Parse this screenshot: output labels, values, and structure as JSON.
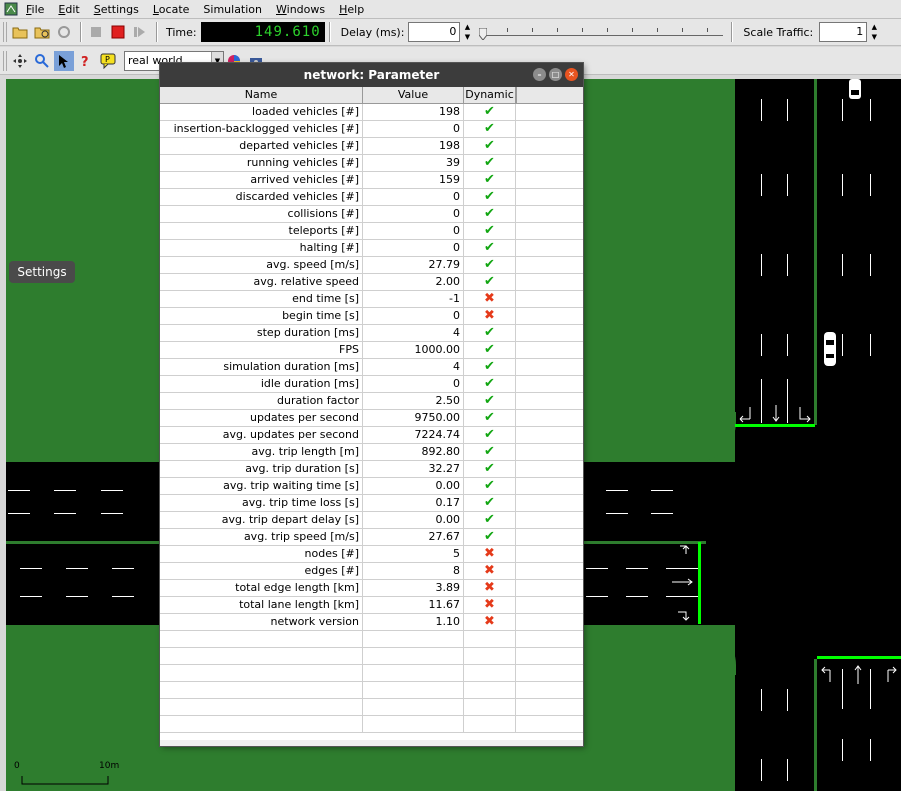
{
  "menu": {
    "items": [
      {
        "pre": "",
        "u": "F",
        "post": "ile"
      },
      {
        "pre": "",
        "u": "E",
        "post": "dit"
      },
      {
        "pre": "",
        "u": "S",
        "post": "ettings"
      },
      {
        "pre": "",
        "u": "L",
        "post": "ocate"
      },
      {
        "pre": "Simulation",
        "u": "",
        "post": ""
      },
      {
        "pre": "",
        "u": "W",
        "post": "indows"
      },
      {
        "pre": "",
        "u": "H",
        "post": "elp"
      }
    ]
  },
  "toolbar": {
    "time_label": "Time:",
    "time_value": "149.610",
    "delay_label": "Delay (ms):",
    "delay_value": "0",
    "scale_traffic_label": "Scale Traffic:",
    "scale_traffic_value": "1",
    "viewport_combo": "real world"
  },
  "canvas": {
    "settings_label": "Settings",
    "scale_start": "0",
    "scale_end": "10m"
  },
  "dialog": {
    "title": "network: Parameter",
    "columns": [
      "Name",
      "Value",
      "Dynamic"
    ],
    "rows": [
      {
        "name": "loaded vehicles [#]",
        "value": "198",
        "dynamic": true
      },
      {
        "name": "insertion-backlogged vehicles [#]",
        "value": "0",
        "dynamic": true
      },
      {
        "name": "departed vehicles [#]",
        "value": "198",
        "dynamic": true
      },
      {
        "name": "running vehicles [#]",
        "value": "39",
        "dynamic": true
      },
      {
        "name": "arrived vehicles [#]",
        "value": "159",
        "dynamic": true
      },
      {
        "name": "discarded vehicles [#]",
        "value": "0",
        "dynamic": true
      },
      {
        "name": "collisions [#]",
        "value": "0",
        "dynamic": true
      },
      {
        "name": "teleports [#]",
        "value": "0",
        "dynamic": true
      },
      {
        "name": "halting [#]",
        "value": "0",
        "dynamic": true
      },
      {
        "name": "avg. speed [m/s]",
        "value": "27.79",
        "dynamic": true
      },
      {
        "name": "avg. relative speed",
        "value": "2.00",
        "dynamic": true
      },
      {
        "name": "end time [s]",
        "value": "-1",
        "dynamic": false
      },
      {
        "name": "begin time [s]",
        "value": "0",
        "dynamic": false
      },
      {
        "name": "step duration [ms]",
        "value": "4",
        "dynamic": true
      },
      {
        "name": "FPS",
        "value": "1000.00",
        "dynamic": true
      },
      {
        "name": "simulation duration [ms]",
        "value": "4",
        "dynamic": true
      },
      {
        "name": "idle duration [ms]",
        "value": "0",
        "dynamic": true
      },
      {
        "name": "duration factor",
        "value": "2.50",
        "dynamic": true
      },
      {
        "name": "updates per second",
        "value": "9750.00",
        "dynamic": true
      },
      {
        "name": "avg. updates per second",
        "value": "7224.74",
        "dynamic": true
      },
      {
        "name": "avg. trip length [m]",
        "value": "892.80",
        "dynamic": true
      },
      {
        "name": "avg. trip duration [s]",
        "value": "32.27",
        "dynamic": true
      },
      {
        "name": "avg. trip waiting time [s]",
        "value": "0.00",
        "dynamic": true
      },
      {
        "name": "avg. trip time loss [s]",
        "value": "0.17",
        "dynamic": true
      },
      {
        "name": "avg. trip depart delay [s]",
        "value": "0.00",
        "dynamic": true
      },
      {
        "name": "avg. trip speed [m/s]",
        "value": "27.67",
        "dynamic": true
      },
      {
        "name": "nodes [#]",
        "value": "5",
        "dynamic": false
      },
      {
        "name": "edges [#]",
        "value": "8",
        "dynamic": false
      },
      {
        "name": "total edge length [km]",
        "value": "3.89",
        "dynamic": false
      },
      {
        "name": "total lane length [km]",
        "value": "11.67",
        "dynamic": false
      },
      {
        "name": "network version",
        "value": "1.10",
        "dynamic": false
      }
    ],
    "empty_rows": 6,
    "dynamic_true_symbol": "✔",
    "dynamic_false_symbol": "✖"
  },
  "colors": {
    "grass": "#2e7d2e",
    "road": "#000000",
    "green_light": "#00ff00",
    "check": "#11a611",
    "cross": "#e53a1a"
  }
}
